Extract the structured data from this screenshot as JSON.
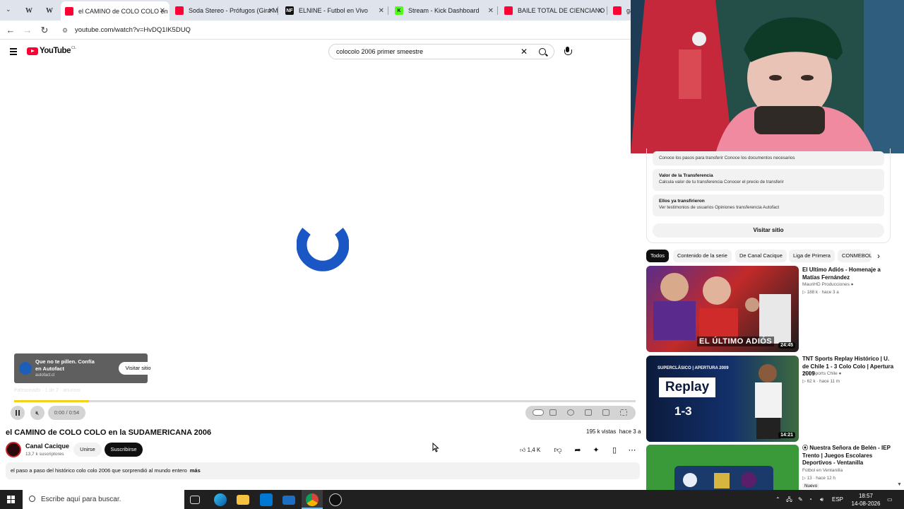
{
  "browser": {
    "tabs": [
      {
        "label": "",
        "favicon": "W"
      },
      {
        "label": "",
        "favicon": "W"
      },
      {
        "label": "el CAMINO de COLO COLO en",
        "favicon": "youtube",
        "active": true
      },
      {
        "label": "Soda Stereo - Prófugos (Gira M",
        "favicon": "youtube"
      },
      {
        "label": "ELNINE - Futbol en Vivo",
        "favicon": "NF"
      },
      {
        "label": "Stream - Kick Dashboard",
        "favicon": "K"
      },
      {
        "label": "BAILE TOTAL DE CIENCIANO Y",
        "favicon": "youtube"
      },
      {
        "label": "ga",
        "favicon": "youtube"
      }
    ],
    "url": "youtube.com/watch?v=HvDQ1IK5DUQ"
  },
  "youtube": {
    "logo_text": "YouTube",
    "country_code": "CL",
    "search_query": "colocolo 2006 primer smeestre"
  },
  "player": {
    "ad_title": "Que no te pillen. Confía en Autofact",
    "ad_domain": "autofact.cl",
    "ad_visit_label": "Visitar sitio",
    "ad_note": "Patrocinado · 1 de 2 · anuncio",
    "time": "0:00 / 0:54",
    "progress_fraction": 0.12
  },
  "video": {
    "title": "el CAMINO de COLO COLO en la SUDAMERICANA 2006",
    "views": "195 k vistas",
    "age": "hace 3 a",
    "channel": "Canal Cacique",
    "subscribers": "13,7 k suscriptores",
    "join_label": "Unirse",
    "subscribe_label": "Suscribirse",
    "likes": "1,4 K",
    "description": "el paso a paso del histórico colo colo 2006 que sorprendió al mundo entero",
    "more_label": "más"
  },
  "sidebar_ad": {
    "rows": [
      {
        "heading": "",
        "sub": "Conoce los pasos para transferir Conoce los documentos necesarios"
      },
      {
        "heading": "Valor de la Transferencia",
        "sub": "Calcula valor de tu transferencia Conocer el precio de transferir"
      },
      {
        "heading": "Ellos ya transfirieron",
        "sub": "Ver testimonios de usuarios Opiniones transferencia Autofact"
      }
    ],
    "visit_label": "Visitar sitio"
  },
  "chips": [
    "Todos",
    "Contenido de la serie",
    "De Canal Cacique",
    "Liga de Primera",
    "CONMEBOL"
  ],
  "recommendations": [
    {
      "title": "El Ultimo Adiós - Homenaje a Matías Fernández",
      "channel": "MauriHD Producciones",
      "stats": "188 k · hace 3 a",
      "duration": "24:45",
      "thumb_text": "EL ÚLTIMO ADIÓS"
    },
    {
      "title": "TNT Sports Replay Histórico | U. de Chile 1 - 3 Colo Colo | Apertura 2009",
      "channel": "TNT Sports Chile",
      "stats": "62 k · hace 11 m",
      "duration": "14:21",
      "thumb_top": "SUPERCLÁSICO | APERTURA 2009",
      "thumb_word": "Replay",
      "thumb_score": "1-3"
    },
    {
      "title": "Nuestra Señora de Belén - IEP Trento | Juegos Escolares Deportivos - Ventanilla",
      "channel": "Fútbol en Ventanilla",
      "stats": "13 · hace 12 h",
      "badge": "Nuevo"
    }
  ],
  "taskbar": {
    "search_placeholder": "Escribe aquí para buscar.",
    "lang": "ESP",
    "time": "18:57",
    "date": "14-08-2026"
  },
  "colors": {
    "youtube_red": "#ff0033",
    "spinner_blue": "#1a56c4",
    "progress_yellow": "#f2d11b"
  }
}
